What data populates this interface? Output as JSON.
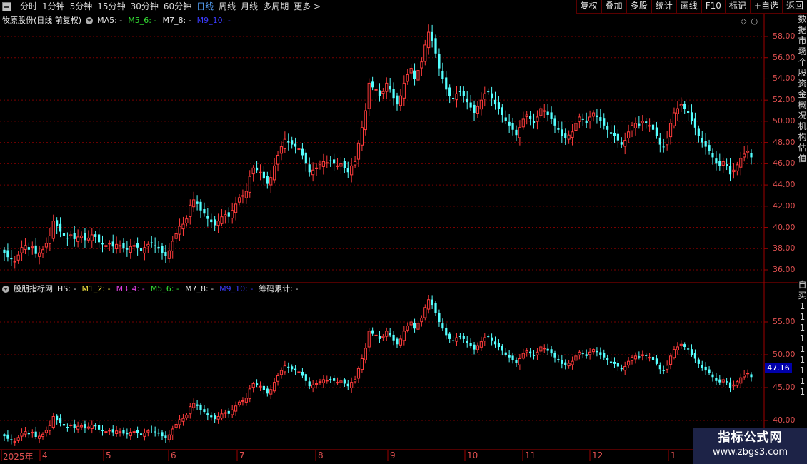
{
  "toolbar": {
    "period_tabs": [
      "分时",
      "1分钟",
      "5分钟",
      "15分钟",
      "30分钟",
      "60分钟",
      "日线",
      "周线",
      "月线",
      "多周期",
      "更多 >"
    ],
    "active_tab": "日线",
    "right_buttons": [
      "复权",
      "叠加",
      "多股",
      "统计",
      "画线",
      "F10",
      "标记",
      "+自选",
      "返回"
    ]
  },
  "main_panel": {
    "title": "牧原股份(日线 前复权)",
    "ma_legend": [
      {
        "label": "MA5: -",
        "color": "#e6e6e6"
      },
      {
        "label": "M5_6: -",
        "color": "#33dd33"
      },
      {
        "label": "M7_8: -",
        "color": "#e6e6e6"
      },
      {
        "label": "M9_10: -",
        "color": "#3b3bff"
      }
    ],
    "y_ticks": [
      "58.00",
      "56.00",
      "54.00",
      "52.00",
      "50.00",
      "48.00",
      "46.00",
      "44.00",
      "42.00",
      "40.00",
      "38.00",
      "36.00"
    ]
  },
  "indicator_panel": {
    "title": "股朋指标网",
    "legend": [
      {
        "label": "HS: -",
        "color": "#e6e6e6"
      },
      {
        "label": "M1_2: -",
        "color": "#f0e040"
      },
      {
        "label": "M3_4: -",
        "color": "#e040e0"
      },
      {
        "label": "M5_6: -",
        "color": "#33dd33"
      },
      {
        "label": "M7_8: -",
        "color": "#e6e6e6"
      },
      {
        "label": "M9_10: -",
        "color": "#3b3bff"
      },
      {
        "label": "筹码累计: -",
        "color": "#e6e6e6"
      }
    ],
    "y_ticks": [
      "55.00",
      "50.00",
      "45.00",
      "40.00"
    ],
    "cursor_price": "47.16"
  },
  "date_axis": [
    "2025年",
    "4",
    "5",
    "6",
    "7",
    "8",
    "9",
    "10",
    "11",
    "12",
    "1"
  ],
  "side_strip_chars": [
    "数",
    "据",
    "市",
    "场",
    "个",
    "股",
    "资",
    "金",
    "概",
    "况",
    "机",
    "构",
    "估",
    "值"
  ],
  "side_strip_lower": [
    "自",
    "买",
    "1",
    "1",
    "1",
    "1",
    "1",
    "1",
    "1",
    "1",
    "1"
  ],
  "watermark": {
    "title": "指标公式网",
    "url": "www.zbgs3.com"
  },
  "colors": {
    "up": "#ff3b3b",
    "down": "#54ffff",
    "grid": "#7a0000",
    "axis_text": "#e05050"
  },
  "chart_data": {
    "type": "candlestick",
    "ylim": [
      35.5,
      59.5
    ],
    "series": [
      {
        "name": "price_close",
        "values": [
          37.6,
          37.2,
          37.0,
          36.8,
          37.4,
          38.1,
          38.3,
          37.9,
          38.2,
          37.5,
          37.6,
          37.9,
          38.5,
          39.2,
          40.6,
          40.1,
          39.6,
          39.2,
          39.0,
          39.3,
          38.9,
          39.1,
          39.2,
          38.8,
          39.0,
          39.3,
          39.1,
          38.6,
          38.4,
          38.3,
          38.5,
          38.2,
          38.4,
          38.3,
          38.0,
          37.9,
          38.2,
          38.3,
          38.1,
          37.8,
          38.1,
          38.4,
          38.5,
          38.3,
          38.0,
          37.6,
          37.3,
          37.8,
          38.7,
          39.4,
          40.1,
          40.3,
          40.8,
          42.1,
          42.6,
          42.2,
          41.6,
          41.3,
          40.8,
          40.5,
          40.2,
          40.6,
          41.0,
          41.2,
          41.0,
          41.6,
          42.2,
          42.8,
          43.0,
          43.4,
          44.8,
          45.6,
          45.4,
          45.2,
          44.6,
          44.1,
          44.7,
          45.8,
          46.8,
          47.6,
          48.3,
          48.0,
          47.8,
          47.6,
          47.4,
          46.8,
          46.0,
          45.2,
          45.4,
          45.6,
          45.9,
          46.2,
          46.1,
          46.3,
          46.0,
          45.8,
          46.0,
          45.6,
          45.2,
          45.8,
          46.2,
          47.9,
          49.4,
          51.0,
          53.6,
          53.2,
          53.0,
          52.4,
          52.8,
          53.6,
          53.0,
          52.2,
          51.6,
          52.4,
          53.6,
          54.4,
          55.0,
          54.0,
          54.8,
          55.6,
          57.2,
          58.4,
          57.6,
          56.4,
          55.0,
          54.0,
          53.0,
          52.4,
          52.2,
          52.6,
          52.8,
          52.4,
          51.8,
          51.3,
          50.8,
          51.4,
          52.0,
          52.6,
          52.8,
          52.2,
          51.6,
          51.2,
          50.6,
          50.0,
          49.6,
          49.2,
          48.7,
          49.4,
          50.2,
          50.6,
          50.2,
          49.8,
          50.4,
          51.2,
          51.0,
          50.6,
          50.2,
          49.6,
          49.2,
          48.6,
          48.4,
          48.7,
          49.0,
          49.8,
          50.4,
          50.2,
          49.8,
          50.4,
          50.8,
          50.4,
          50.0,
          49.6,
          49.2,
          48.8,
          48.6,
          48.2,
          47.8,
          48.2,
          49.0,
          49.6,
          49.8,
          49.6,
          50.0,
          49.8,
          49.6,
          49.2,
          48.6,
          47.8,
          47.6,
          48.4,
          49.8,
          50.8,
          51.2,
          51.6,
          51.2,
          50.8,
          50.0,
          49.4,
          48.6,
          48.0,
          47.6,
          47.2,
          46.6,
          46.0,
          45.8,
          46.2,
          45.8,
          45.0,
          45.4,
          45.9,
          46.5,
          46.9,
          47.2,
          46.6
        ]
      }
    ],
    "xlabel": "",
    "ylabel": ""
  }
}
